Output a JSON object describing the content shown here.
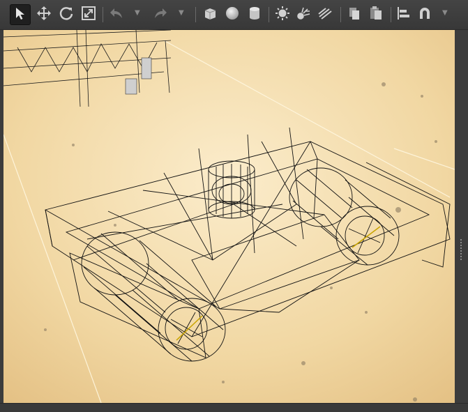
{
  "toolbar": {
    "tools": [
      {
        "name": "select",
        "icon": "select-arrow-icon",
        "active": true
      },
      {
        "name": "move",
        "icon": "move-icon"
      },
      {
        "name": "rotate",
        "icon": "rotate-icon"
      },
      {
        "name": "scale",
        "icon": "scale-icon"
      },
      {
        "name": "undo",
        "icon": "undo-icon"
      },
      {
        "name": "redo",
        "icon": "redo-icon"
      },
      {
        "name": "add-box",
        "icon": "cube-icon"
      },
      {
        "name": "add-sphere",
        "icon": "sphere-icon"
      },
      {
        "name": "add-cylinder",
        "icon": "cylinder-icon"
      },
      {
        "name": "add-sun-light",
        "icon": "sun-light-icon"
      },
      {
        "name": "add-point-light",
        "icon": "point-light-icon"
      },
      {
        "name": "add-spot-light",
        "icon": "spot-light-icon"
      },
      {
        "name": "copy",
        "icon": "copy-icon"
      },
      {
        "name": "paste",
        "icon": "paste-icon"
      },
      {
        "name": "align",
        "icon": "align-icon"
      },
      {
        "name": "snap",
        "icon": "magnet-icon"
      }
    ],
    "colors": {
      "bg": "#3e3e3e",
      "icon": "#d0d0d0",
      "icon_disabled": "#7a7a7a"
    }
  },
  "viewport": {
    "mode": "wireframe",
    "ground_color": "#f0d9a6",
    "wire_color": "#111111"
  }
}
